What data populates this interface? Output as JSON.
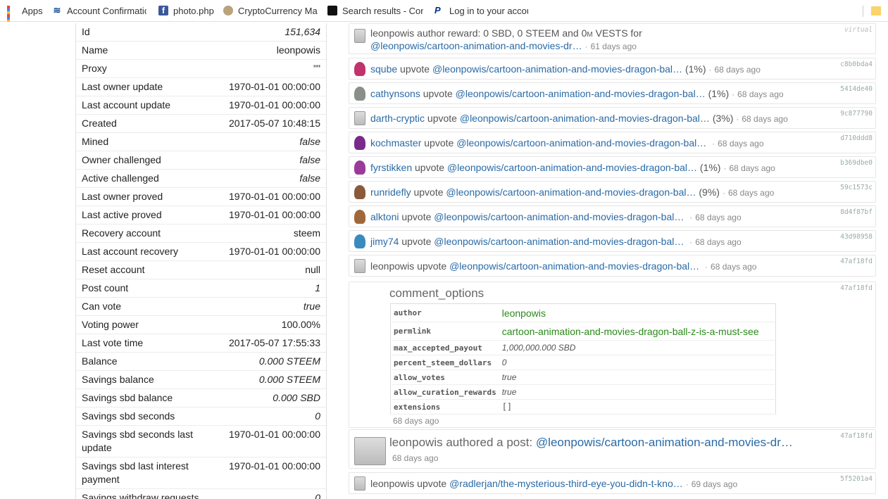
{
  "bookmarks": [
    {
      "label": "Apps",
      "icon": "apps-grid-icon"
    },
    {
      "label": "Account Confirmatio",
      "icon": "steem-icon"
    },
    {
      "label": "photo.php",
      "icon": "facebook-icon"
    },
    {
      "label": "CryptoCurrency Mark",
      "icon": "coin-icon"
    },
    {
      "label": "Search results - Cont",
      "icon": "kodak-icon"
    },
    {
      "label": "Log in to your accour",
      "icon": "paypal-icon"
    }
  ],
  "account": [
    {
      "key": "Id",
      "value": "151,634",
      "italic": true
    },
    {
      "key": "Name",
      "value": "leonpowis",
      "italic": false
    },
    {
      "key": "Proxy",
      "value": "\"\"",
      "italic": false
    },
    {
      "key": "Last owner update",
      "value": "1970-01-01 00:00:00",
      "italic": false
    },
    {
      "key": "Last account update",
      "value": "1970-01-01 00:00:00",
      "italic": false
    },
    {
      "key": "Created",
      "value": "2017-05-07 10:48:15",
      "italic": false
    },
    {
      "key": "Mined",
      "value": "false",
      "italic": true
    },
    {
      "key": "Owner challenged",
      "value": "false",
      "italic": true
    },
    {
      "key": "Active challenged",
      "value": "false",
      "italic": true
    },
    {
      "key": "Last owner proved",
      "value": "1970-01-01 00:00:00",
      "italic": false
    },
    {
      "key": "Last active proved",
      "value": "1970-01-01 00:00:00",
      "italic": false
    },
    {
      "key": "Recovery account",
      "value": "steem",
      "italic": false
    },
    {
      "key": "Last account recovery",
      "value": "1970-01-01 00:00:00",
      "italic": false
    },
    {
      "key": "Reset account",
      "value": "null",
      "italic": false
    },
    {
      "key": "Post count",
      "value": "1",
      "italic": true
    },
    {
      "key": "Can vote",
      "value": "true",
      "italic": true
    },
    {
      "key": "Voting power",
      "value": "100.00%",
      "italic": false
    },
    {
      "key": "Last vote time",
      "value": "2017-05-07 17:55:33",
      "italic": false
    },
    {
      "key": "Balance",
      "value": "0.000 STEEM",
      "italic": true
    },
    {
      "key": "Savings balance",
      "value": "0.000 STEEM",
      "italic": true
    },
    {
      "key": "Savings sbd balance",
      "value": "0.000 SBD",
      "italic": true
    },
    {
      "key": "Savings sbd seconds",
      "value": "0",
      "italic": true
    },
    {
      "key": "Savings sbd seconds last update",
      "value": "1970-01-01 00:00:00",
      "italic": false
    },
    {
      "key": "Savings sbd last interest payment",
      "value": "1970-01-01 00:00:00",
      "italic": false
    },
    {
      "key": "Savings withdraw requests",
      "value": "0",
      "italic": true
    }
  ],
  "reward": {
    "line1": "leonpowis author reward: 0 SBD, 0 STEEM and 0",
    "m": "M",
    "line1_end": " VESTS for",
    "link": "@leonpowis/cartoon-animation-and-movies-dr…",
    "ago": "61 days ago",
    "hash": "virtual"
  },
  "votes": [
    {
      "voter": "sqube",
      "action": "upvote",
      "link": "@leonpowis/cartoon-animation-and-movies-dragon-bal…",
      "pct": "(1%)",
      "ago": "68 days ago",
      "hash": "c8b0bda4",
      "avatar_color": "#c0336d"
    },
    {
      "voter": "cathynsons",
      "action": "upvote",
      "link": "@leonpowis/cartoon-animation-and-movies-dragon-bal…",
      "pct": "(1%)",
      "ago": "68 days ago",
      "hash": "5414de40",
      "avatar_color": "#8a8f8a"
    },
    {
      "voter": "darth-cryptic",
      "action": "upvote",
      "link": "@leonpowis/cartoon-animation-and-movies-dragon-bal…",
      "pct": "(3%)",
      "ago": "68 days ago",
      "hash": "9c877790",
      "avatar_color": "robot"
    },
    {
      "voter": "kochmaster",
      "action": "upvote",
      "link": "@leonpowis/cartoon-animation-and-movies-dragon-bal…",
      "pct": "",
      "ago": "68 days ago",
      "hash": "d710ddd8",
      "avatar_color": "#7a2a8a"
    },
    {
      "voter": "fyrstikken",
      "action": "upvote",
      "link": "@leonpowis/cartoon-animation-and-movies-dragon-bal…",
      "pct": "(1%)",
      "ago": "68 days ago",
      "hash": "b369dbe0",
      "avatar_color": "#9a3a9a"
    },
    {
      "voter": "runridefly",
      "action": "upvote",
      "link": "@leonpowis/cartoon-animation-and-movies-dragon-bal…",
      "pct": "(9%)",
      "ago": "68 days ago",
      "hash": "59c1573c",
      "avatar_color": "#8a5a3a"
    },
    {
      "voter": "alktoni",
      "action": "upvote",
      "link": "@leonpowis/cartoon-animation-and-movies-dragon-bal…",
      "pct": "",
      "ago": "68 days ago",
      "hash": "8d4f87bf",
      "avatar_color": "#a0683a"
    },
    {
      "voter": "jimy74",
      "action": "upvote",
      "link": "@leonpowis/cartoon-animation-and-movies-dragon-bal…",
      "pct": "",
      "ago": "68 days ago",
      "hash": "43d98958",
      "avatar_color": "#3a8ac0"
    },
    {
      "voter": "leonpowis",
      "action": "upvote",
      "link": "@leonpowis/cartoon-animation-and-movies-dragon-bal…",
      "pct": "",
      "ago": "68 days ago",
      "hash": "47af18fd",
      "avatar_color": "robot",
      "voter_plain": true
    }
  ],
  "comment_options": {
    "title": "comment_options",
    "hash": "47af18fd",
    "rows": [
      {
        "key": "author",
        "value": "leonpowis",
        "style": "green"
      },
      {
        "key": "permlink",
        "value": "cartoon-animation-and-movies-dragon-ball-z-is-a-must-see",
        "style": "green"
      },
      {
        "key": "max_accepted_payout",
        "value": "1,000,000.000 SBD",
        "style": "it"
      },
      {
        "key": "percent_steem_dollars",
        "value": "0",
        "style": "it"
      },
      {
        "key": "allow_votes",
        "value": "true",
        "style": "it"
      },
      {
        "key": "allow_curation_rewards",
        "value": "true",
        "style": "it"
      },
      {
        "key": "extensions",
        "value": "[]",
        "style": "mono"
      }
    ],
    "ago": "68 days ago"
  },
  "post": {
    "author": "leonpowis authored a post: ",
    "link": "@leonpowis/cartoon-animation-and-movies-dr…",
    "ago": "68 days ago",
    "hash": "47af18fd"
  },
  "last_vote": {
    "voter": "leonpowis upvote ",
    "link": "@radlerjan/the-mysterious-third-eye-you-didn-t-kno…",
    "ago": "69 days ago",
    "hash": "5f5201a4"
  }
}
